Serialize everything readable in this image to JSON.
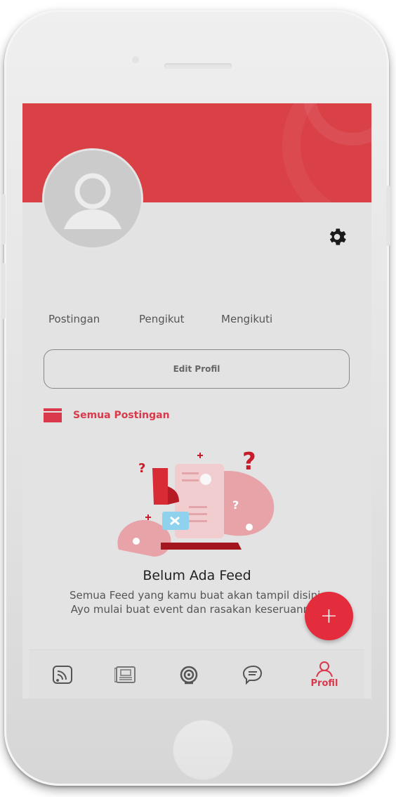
{
  "profile": {
    "stats": {
      "posts_label": "Postingan",
      "followers_label": "Pengikut",
      "following_label": "Mengikuti"
    },
    "edit_button_label": "Edit Profil",
    "section_title": "Semua Postingan",
    "empty_state": {
      "title": "Belum Ada Feed",
      "description": "Semua Feed yang kamu buat akan tampil disini. Ayo mulai buat event dan rasakan keseruannya"
    },
    "fab_label": "+"
  },
  "bottom_nav": {
    "items": [
      {
        "icon": "feed-icon",
        "label": ""
      },
      {
        "icon": "news-icon",
        "label": ""
      },
      {
        "icon": "podcast-icon",
        "label": ""
      },
      {
        "icon": "chat-icon",
        "label": ""
      },
      {
        "icon": "profile-icon",
        "label": "Profil"
      }
    ],
    "active_index": 4
  },
  "icons": {
    "settings": "gear-icon",
    "section": "posts-icon",
    "avatar": "avatar-placeholder-icon"
  },
  "colors": {
    "brand": "#d94146",
    "accent": "#e32d3d",
    "active_text": "#d9394a",
    "nav_icon": "#555555"
  }
}
